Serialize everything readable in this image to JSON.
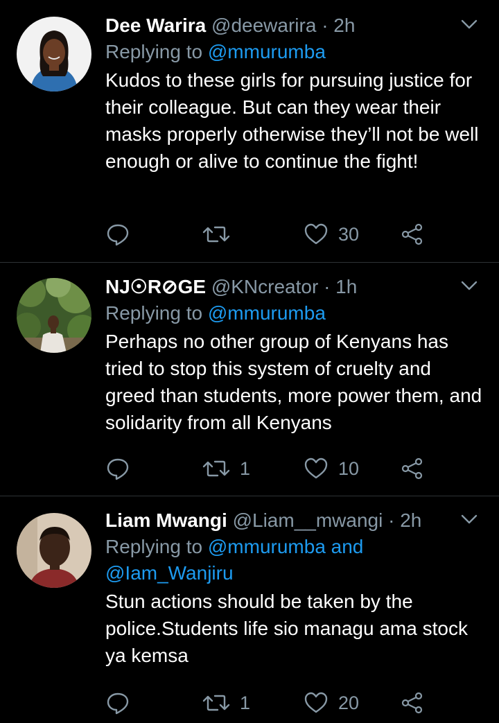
{
  "colors": {
    "background": "#000000",
    "muted": "#8899a6",
    "accent": "#1d9bf0",
    "divider": "#2f3336"
  },
  "tweets": [
    {
      "display_name": "Dee Warira",
      "handle": "@deewarira",
      "separator": "·",
      "time": "2h",
      "replying_prefix": "Replying to",
      "mention_1": "@mmurumba",
      "text": "Kudos to these girls for pursuing justice for their colleague. But can they wear their masks properly otherwise they’ll not be well enough or alive to continue the fight!",
      "retweet_count": "",
      "like_count": "30",
      "icons": [
        "reply-icon",
        "retweet-icon",
        "like-icon",
        "share-icon",
        "chevron-down-icon"
      ]
    },
    {
      "display_name": "NJ☉R⊘GE",
      "handle": "@KNcreator",
      "separator": "·",
      "time": "1h",
      "replying_prefix": "Replying to",
      "mention_1": "@mmurumba",
      "text": "Perhaps no other group of Kenyans has tried to stop this system of cruelty and greed than students, more power them, and solidarity from all Kenyans",
      "retweet_count": "1",
      "like_count": "10",
      "icons": [
        "reply-icon",
        "retweet-icon",
        "like-icon",
        "share-icon",
        "chevron-down-icon"
      ]
    },
    {
      "display_name": "Liam Mwangi",
      "handle": "@Liam__mwangi",
      "separator": "·",
      "time": "2h",
      "replying_prefix": "Replying to",
      "mention_1": "@mmurumba and",
      "mention_2": "@Iam_Wanjiru",
      "text": "Stun actions should be taken by the police.Students life sio managu ama stock ya kemsa",
      "retweet_count": "1",
      "like_count": "20",
      "icons": [
        "reply-icon",
        "retweet-icon",
        "like-icon",
        "share-icon",
        "chevron-down-icon"
      ]
    }
  ]
}
